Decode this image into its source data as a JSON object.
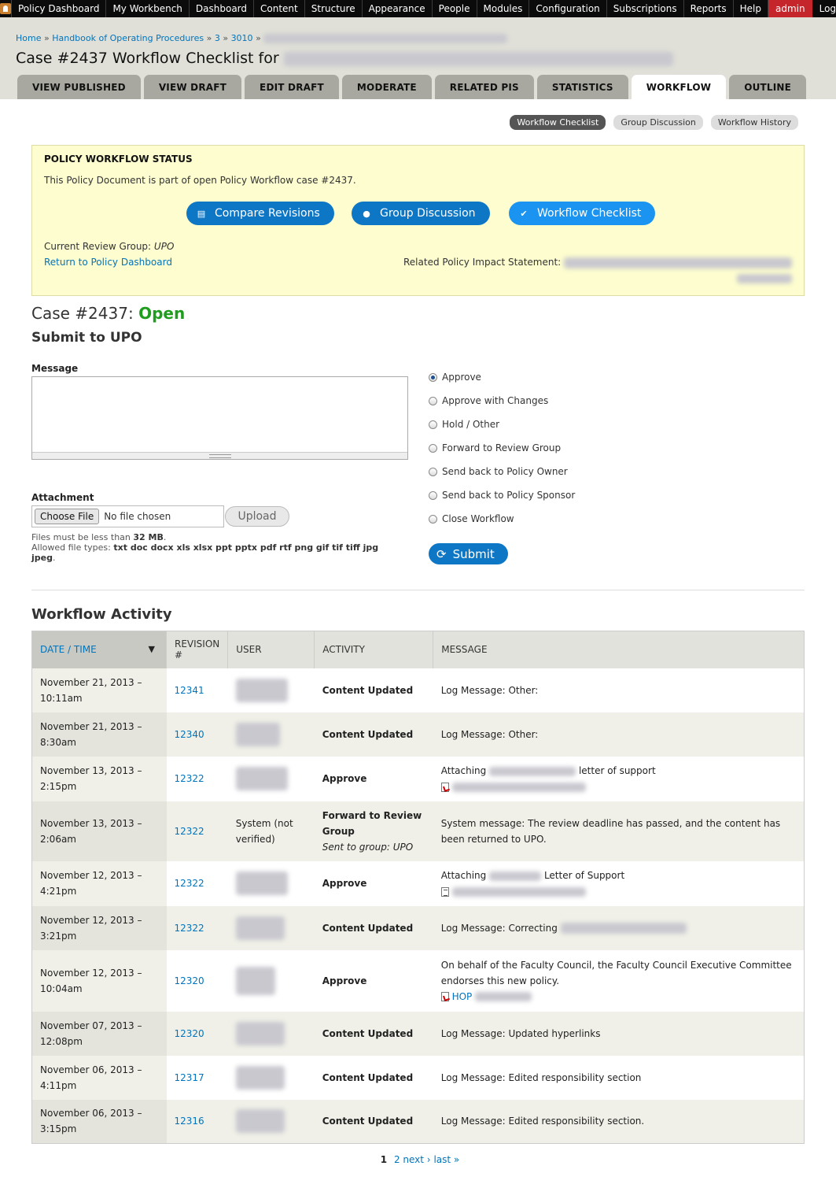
{
  "toolbar": {
    "items": [
      "Policy Dashboard",
      "My Workbench",
      "Dashboard",
      "Content",
      "Structure",
      "Appearance",
      "People",
      "Modules",
      "Configuration",
      "Subscriptions",
      "Reports",
      "Help"
    ],
    "user": "admin",
    "logout": "Log out"
  },
  "breadcrumb": {
    "home": "Home",
    "sep": "»",
    "handbook": "Handbook of Operating Procedures",
    "level": "3",
    "number": "3010"
  },
  "page_title": "Case #2437 Workflow Checklist for",
  "tabs": [
    "VIEW PUBLISHED",
    "VIEW DRAFT",
    "EDIT DRAFT",
    "MODERATE",
    "RELATED PIS",
    "STATISTICS",
    "WORKFLOW",
    "OUTLINE"
  ],
  "active_tab": "WORKFLOW",
  "subtabs": [
    "Workflow Checklist",
    "Group Discussion",
    "Workflow History"
  ],
  "status": {
    "heading": "POLICY WORKFLOW STATUS",
    "description": "This Policy Document is part of open Policy Workflow case #2437.",
    "buttons": [
      "Compare Revisions",
      "Group Discussion",
      "Workflow Checklist"
    ],
    "review_group_label": "Current Review Group:",
    "review_group": "UPO",
    "return_link": "Return to Policy Dashboard",
    "related_label": "Related Policy Impact Statement:"
  },
  "case": {
    "title": "Case #2437:",
    "state": "Open",
    "subtitle": "Submit to UPO"
  },
  "form": {
    "message_label": "Message",
    "attachment_label": "Attachment",
    "choose_file": "Choose File",
    "no_file": "No file chosen",
    "upload": "Upload",
    "size_text": "Files must be less than",
    "size_value": "32 MB",
    "types_text": "Allowed file types:",
    "types_value": "txt doc docx xls xlsx ppt pptx pdf rtf png gif tif tiff jpg jpeg",
    "options": [
      "Approve",
      "Approve with Changes",
      "Hold / Other",
      "Forward to Review Group",
      "Send back to Policy Owner",
      "Send back to Policy Sponsor",
      "Close Workflow"
    ],
    "selected": "Approve",
    "submit": "Submit"
  },
  "activity": {
    "title": "Workflow Activity",
    "columns": [
      "DATE / TIME",
      "REVISION #",
      "USER",
      "ACTIVITY",
      "MESSAGE"
    ],
    "rows": [
      {
        "date": "November 21, 2013 –",
        "time": "10:11am",
        "rev": "12341",
        "user": "",
        "activity": "Content Updated",
        "sub": "",
        "message": "Log Message: Other:",
        "attach": ""
      },
      {
        "date": "November 21, 2013 –",
        "time": "8:30am",
        "rev": "12340",
        "user": "",
        "activity": "Content Updated",
        "sub": "",
        "message": "Log Message: Other:",
        "attach": ""
      },
      {
        "date": "November 13, 2013 –",
        "time": "2:15pm",
        "rev": "12322",
        "user": "",
        "activity": "Approve",
        "sub": "",
        "message": "Attaching",
        "message_tail": "letter of support",
        "attach": "pdf"
      },
      {
        "date": "November 13, 2013 –",
        "time": "2:06am",
        "rev": "12322",
        "user": "System (not verified)",
        "activity": "Forward to Review Group",
        "sub": "Sent to group: UPO",
        "message": "System message: The review deadline has passed, and the content has been returned to UPO.",
        "attach": ""
      },
      {
        "date": "November 12, 2013 –",
        "time": "4:21pm",
        "rev": "12322",
        "user": "",
        "activity": "Approve",
        "sub": "",
        "message": "Attaching",
        "message_tail": "Letter of Support",
        "attach": "txt"
      },
      {
        "date": "November 12, 2013 –",
        "time": "3:21pm",
        "rev": "12322",
        "user": "",
        "activity": "Content Updated",
        "sub": "",
        "message": "Log Message: Correcting",
        "attach": ""
      },
      {
        "date": "November 12, 2013 –",
        "time": "10:04am",
        "rev": "12320",
        "user": "",
        "activity": "Approve",
        "sub": "",
        "message": "On behalf of the Faculty Council, the Faculty Council Executive Committee endorses this new policy.",
        "attach": "pdf",
        "attach_label": "HOP"
      },
      {
        "date": "November 07, 2013 –",
        "time": "12:08pm",
        "rev": "12320",
        "user": "",
        "activity": "Content Updated",
        "sub": "",
        "message": "Log Message: Updated hyperlinks",
        "attach": ""
      },
      {
        "date": "November 06, 2013 –",
        "time": "4:11pm",
        "rev": "12317",
        "user": "",
        "activity": "Content Updated",
        "sub": "",
        "message": "Log Message: Edited responsibility section",
        "attach": ""
      },
      {
        "date": "November 06, 2013 –",
        "time": "3:15pm",
        "rev": "12316",
        "user": "",
        "activity": "Content Updated",
        "sub": "",
        "message": "Log Message: Edited responsibility section.",
        "attach": ""
      }
    ]
  },
  "pager": {
    "current": "1",
    "next_page": "2",
    "next": "next ›",
    "last": "last »"
  },
  "colors": {
    "toolbar": "#0b0b0b",
    "admin": "#c5262b",
    "button": "#0d77c6",
    "open": "#1f9d1f",
    "status_bg": "#fdfdcf"
  }
}
